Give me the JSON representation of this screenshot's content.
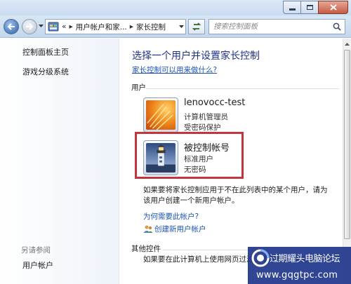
{
  "window": {
    "min_glyph": "—",
    "max_glyph": "□",
    "close_glyph": "✕"
  },
  "nav": {
    "address": {
      "overflow": "«",
      "segments": [
        "用户帐户和家...",
        "家长控制"
      ],
      "separator": "▸"
    },
    "search_placeholder": "搜索控制面板"
  },
  "sidebar": {
    "items": [
      {
        "label": "控制面板主页"
      },
      {
        "label": "游戏分级系统"
      }
    ],
    "see_also_title": "另请参阅",
    "see_also_items": [
      {
        "label": "用户帐户"
      }
    ]
  },
  "main": {
    "heading": "选择一个用户并设置家长控制",
    "help_link": "家长控制可以用来做什么?",
    "users_section": "用户",
    "users": [
      {
        "name": "lenovocc-test",
        "role": "计算机管理员",
        "password": "受密码保护",
        "avatar": "flower"
      },
      {
        "name": "被控制帐号",
        "role": "标准用户",
        "password": "无密码",
        "avatar": "lighthouse"
      }
    ],
    "note": "如果要将家长控制应用于不在此列表中的某个用户，请为该用户创建一个新用户帐户。",
    "why_link": "为何需要此帐户?",
    "create_link": "创建新用户帐户",
    "other_section": "其他控件",
    "other_note": "如果要在此计算机上使用网页过滤... 需要安装其他控件。"
  },
  "watermark": {
    "line1": "过期耀头电脑论坛",
    "line2": "www.gqgtpc.com"
  },
  "colors": {
    "accent_link": "#1b54b5",
    "heading": "#1e3287",
    "highlight_border": "#c2353f",
    "watermark_bg": "#20388c"
  }
}
